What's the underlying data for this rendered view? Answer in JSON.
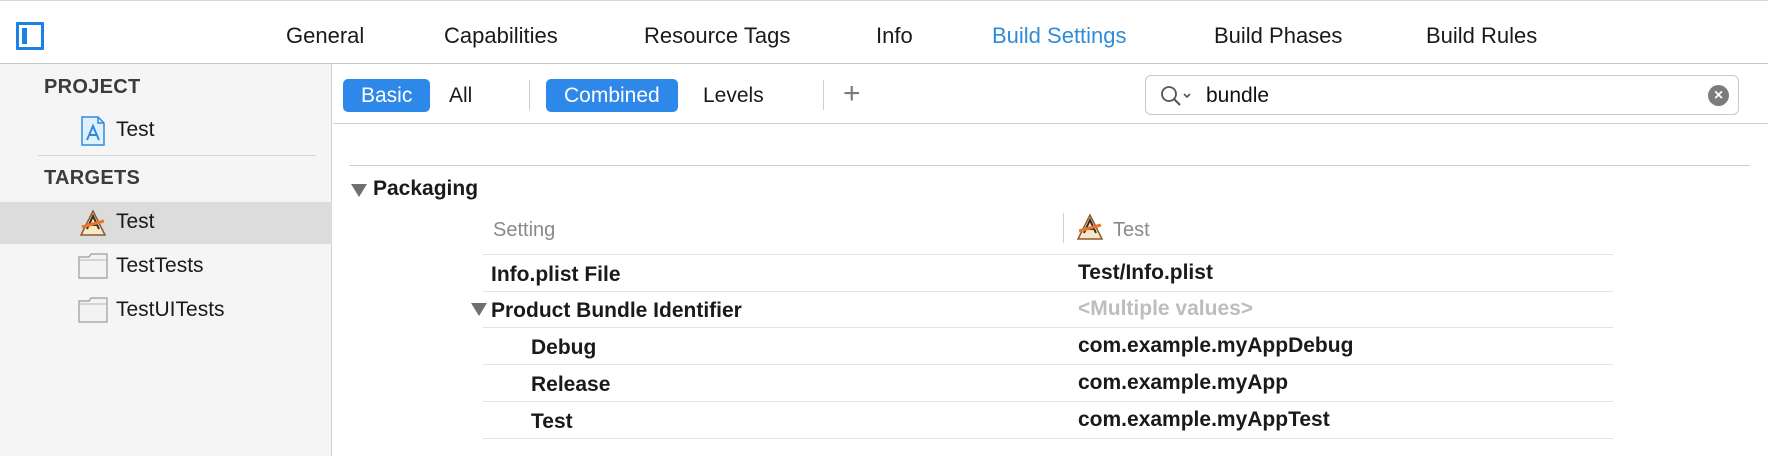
{
  "tabs": [
    {
      "label": "General",
      "active": false
    },
    {
      "label": "Capabilities",
      "active": false
    },
    {
      "label": "Resource Tags",
      "active": false
    },
    {
      "label": "Info",
      "active": false
    },
    {
      "label": "Build Settings",
      "active": true
    },
    {
      "label": "Build Phases",
      "active": false
    },
    {
      "label": "Build Rules",
      "active": false
    }
  ],
  "sidebar": {
    "project_header": "PROJECT",
    "project_item": "Test",
    "targets_header": "TARGETS",
    "targets": [
      {
        "label": "Test",
        "icon": "app-target-icon",
        "selected": true
      },
      {
        "label": "TestTests",
        "icon": "test-bundle-icon",
        "selected": false
      },
      {
        "label": "TestUITests",
        "icon": "test-bundle-icon",
        "selected": false
      }
    ]
  },
  "toolbar": {
    "basic": "Basic",
    "all": "All",
    "combined": "Combined",
    "levels": "Levels",
    "add": "+"
  },
  "search": {
    "value": "bundle"
  },
  "group": {
    "title": "Packaging"
  },
  "columns": {
    "setting": "Setting",
    "target": "Test"
  },
  "rows": [
    {
      "name": "Info.plist File",
      "value": "Test/Info.plist"
    },
    {
      "name": "Product Bundle Identifier",
      "value": "<Multiple values>"
    },
    {
      "name": "Debug",
      "value": "com.example.myAppDebug"
    },
    {
      "name": "Release",
      "value": "com.example.myApp"
    },
    {
      "name": "Test",
      "value": "com.example.myAppTest"
    }
  ],
  "colors": {
    "accent": "#2d88ea",
    "active_tab": "#2f8cda"
  }
}
